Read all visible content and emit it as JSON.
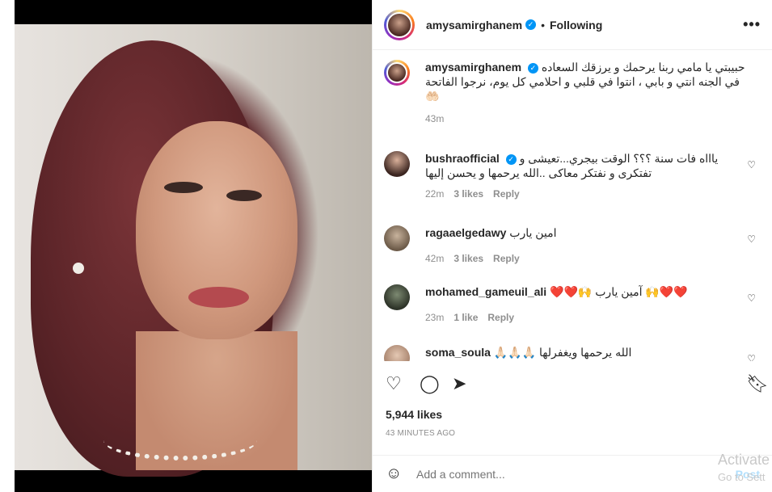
{
  "post": {
    "username": "amysamirghanem",
    "follow_status": "Following",
    "more_icon": "•••",
    "caption": "حبيبتي يا مامي ربنا يرحمك و يرزقك السعاده في الجنه انتي و بابي ، انتوا في قلبي و احلامي كل يوم، نرجوا الفاتحة 🤲🏻",
    "caption_time": "43m"
  },
  "comments": [
    {
      "username": "bushraofficial",
      "verified": true,
      "text": "ياااه فات سنة ؟؟؟ الوقت بيجري...تعيشى و تفتكرى و نفتكر معاكى ..الله يرحمها و يحسن إليها",
      "time": "22m",
      "likes": "3 likes",
      "reply": "Reply"
    },
    {
      "username": "ragaaelgedawy",
      "verified": false,
      "text": "امين يارب",
      "time": "42m",
      "likes": "3 likes",
      "reply": "Reply"
    },
    {
      "username": "mohamed_gameuil_ali",
      "verified": false,
      "text": "❤️❤️🙌 آمين يارب 🙌❤️❤️",
      "time": "23m",
      "likes": "1 like",
      "reply": "Reply"
    },
    {
      "username": "soma_soula",
      "verified": false,
      "text": "الله يرحمها ويغفرلها 🙏🏻🙏🏻🙏🏻",
      "time": "",
      "likes": "",
      "reply": ""
    }
  ],
  "stats": {
    "likes": "5,944 likes",
    "posted_ago": "43 MINUTES AGO"
  },
  "composer": {
    "placeholder": "Add a comment...",
    "post_label": "Post"
  },
  "watermark": {
    "line1": "Activate",
    "line2": "Go to Sett"
  },
  "colors": {
    "verified": "#0095f6",
    "post_disabled": "#b2dffc",
    "muted": "#8e8e8e"
  }
}
